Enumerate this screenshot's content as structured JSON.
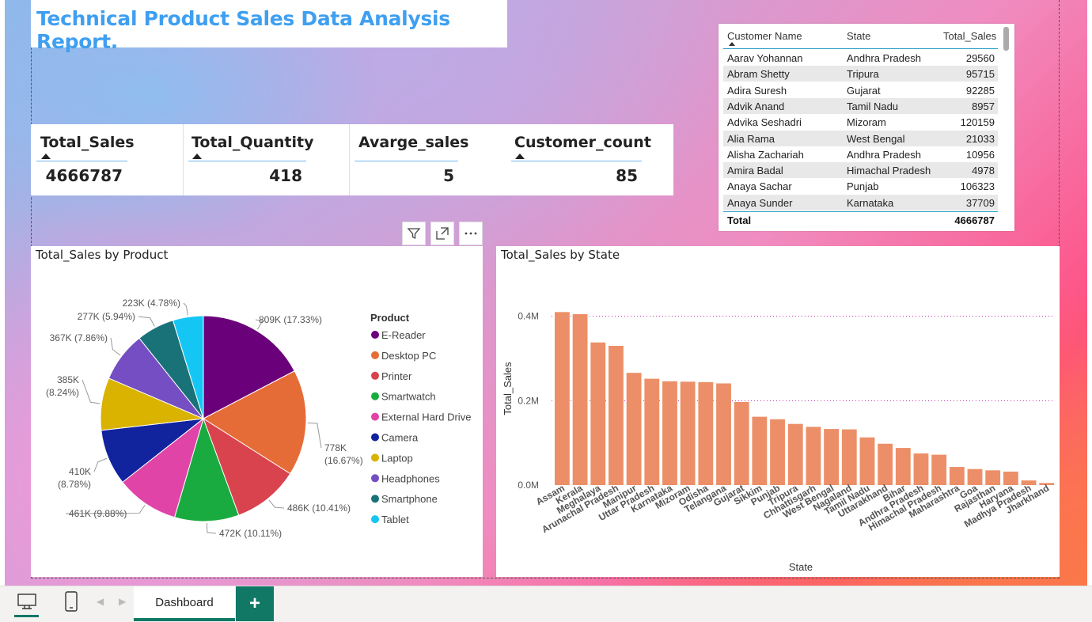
{
  "report_title": "Technical Product Sales Data Analysis Report.",
  "kpis": [
    {
      "title": "Total_Sales",
      "value": "4666787"
    },
    {
      "title": "Total_Quantity",
      "value": "418"
    },
    {
      "title": "Avarge_sales",
      "value": "5"
    },
    {
      "title": "Customer_count",
      "value": "85"
    }
  ],
  "customer_table": {
    "headers": [
      "Customer Name",
      "State",
      "Total_Sales"
    ],
    "rows": [
      [
        "Aarav Yohannan",
        "Andhra Pradesh",
        "29560"
      ],
      [
        "Abram Shetty",
        "Tripura",
        "95715"
      ],
      [
        "Adira Suresh",
        "Gujarat",
        "92285"
      ],
      [
        "Advik Anand",
        "Tamil Nadu",
        "8957"
      ],
      [
        "Advika Seshadri",
        "Mizoram",
        "120159"
      ],
      [
        "Alia Rama",
        "West Bengal",
        "21033"
      ],
      [
        "Alisha Zachariah",
        "Andhra Pradesh",
        "10956"
      ],
      [
        "Amira Badal",
        "Himachal Pradesh",
        "4978"
      ],
      [
        "Anaya Sachar",
        "Punjab",
        "106323"
      ],
      [
        "Anaya Sunder",
        "Karnataka",
        "37709"
      ]
    ],
    "total_label": "Total",
    "total_value": "4666787"
  },
  "visual_header_icons": [
    "filter-icon",
    "focus-mode-icon",
    "more-options-icon"
  ],
  "chart_data": [
    {
      "type": "pie",
      "title": "Total_Sales by Product",
      "legend_title": "Product",
      "legend_position": "right",
      "slices": [
        {
          "name": "E-Reader",
          "value": 809000,
          "label": "809K (17.33%)",
          "color": "#6b007b"
        },
        {
          "name": "Desktop PC",
          "value": 778000,
          "label": "778K (16.67%)",
          "color": "#e66c37"
        },
        {
          "name": "Printer",
          "value": 486000,
          "label": "486K (10.41%)",
          "color": "#d9434e"
        },
        {
          "name": "Smartwatch",
          "value": 472000,
          "label": "472K (10.11%)",
          "color": "#1aab40"
        },
        {
          "name": "External Hard Drive",
          "value": 461000,
          "label": "461K (9.88%)",
          "color": "#e044a7"
        },
        {
          "name": "Camera",
          "value": 410000,
          "label": "410K (8.78%)",
          "color": "#12239e"
        },
        {
          "name": "Laptop",
          "value": 385000,
          "label": "385K (8.24%)",
          "color": "#d9b300"
        },
        {
          "name": "Headphones",
          "value": 367000,
          "label": "367K (7.86%)",
          "color": "#744ec2"
        },
        {
          "name": "Smartphone",
          "value": 277000,
          "label": "277K (5.94%)",
          "color": "#197278"
        },
        {
          "name": "Tablet",
          "value": 223000,
          "label": "223K (4.78%)",
          "color": "#15c6f4"
        }
      ]
    },
    {
      "type": "bar",
      "title": "Total_Sales by State",
      "xlabel": "State",
      "ylabel": "Total_Sales",
      "ylim": [
        0,
        450000
      ],
      "yticks": [
        {
          "value": 0,
          "label": "0.0M"
        },
        {
          "value": 200000,
          "label": "0.2M"
        },
        {
          "value": 400000,
          "label": "0.4M"
        }
      ],
      "grid": true,
      "bar_color": "#ec8f68",
      "categories": [
        "Assam",
        "Kerala",
        "Meghalaya",
        "Arunachal Pradesh",
        "Manipur",
        "Uttar Pradesh",
        "Karnataka",
        "Mizoram",
        "Odisha",
        "Telangana",
        "Gujarat",
        "Sikkim",
        "Punjab",
        "Tripura",
        "Chhattisgarh",
        "West Bengal",
        "Nagaland",
        "Tamil Nadu",
        "Uttarakhand",
        "Bihar",
        "Andhra Pradesh",
        "Himachal Pradesh",
        "Maharashtra",
        "Goa",
        "Rajasthan",
        "Haryana",
        "Madhya Pradesh",
        "Jharkhand"
      ],
      "values": [
        410000,
        405000,
        338000,
        330000,
        266000,
        252000,
        246000,
        245000,
        244000,
        241000,
        197000,
        162000,
        156000,
        145000,
        138000,
        133000,
        132000,
        113000,
        98000,
        88000,
        75000,
        72000,
        43000,
        38000,
        35000,
        32000,
        11000,
        5000
      ]
    }
  ],
  "tabs": {
    "pages": [
      "Dashboard"
    ],
    "add_label": "+"
  }
}
